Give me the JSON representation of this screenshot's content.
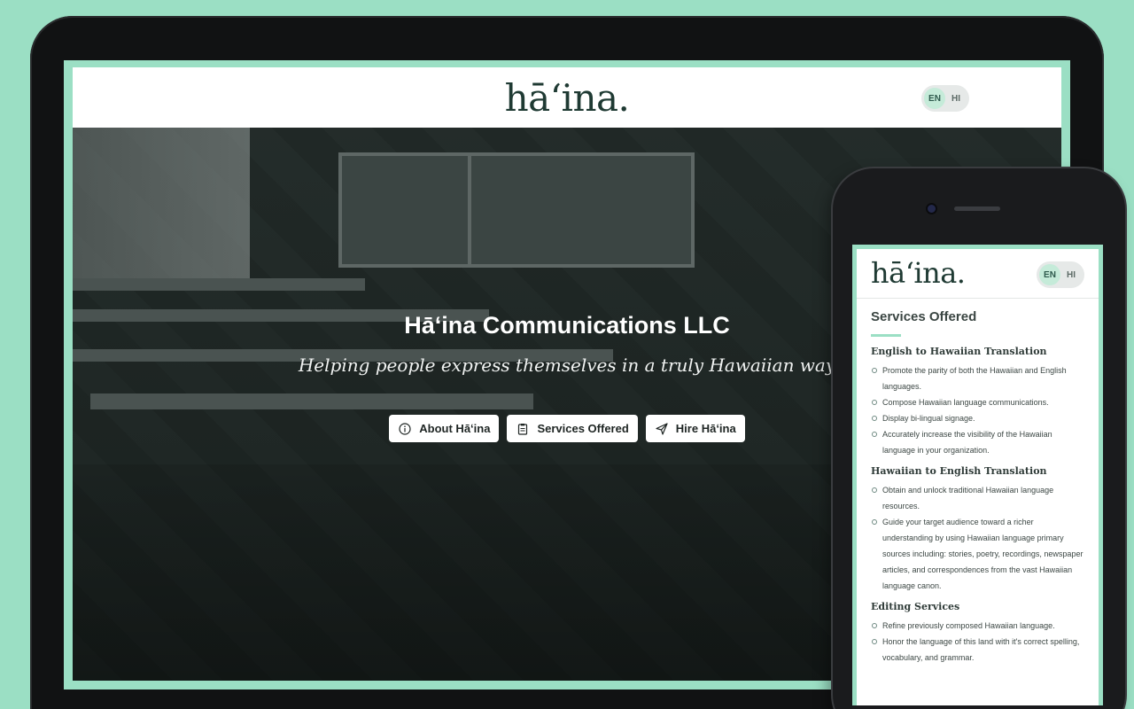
{
  "brand": {
    "logo_text": "hāʻina."
  },
  "lang": {
    "en": "EN",
    "hi": "HI"
  },
  "hero": {
    "title": "Hāʻina Communications LLC",
    "subtitle": "Helping people express themselves in a truly Hawaiian way",
    "buttons": [
      {
        "label": "About Hāʻina",
        "icon": "info-icon"
      },
      {
        "label": "Services Offered",
        "icon": "clipboard-icon"
      },
      {
        "label": "Hire Hāʻina",
        "icon": "send-icon"
      }
    ]
  },
  "mobile": {
    "section_title": "Services Offered",
    "services": [
      {
        "heading": "English to Hawaiian Translation",
        "items": [
          "Promote the parity of both the Hawaiian and English languages.",
          "Compose Hawaiian language communications.",
          "Display bi-lingual signage.",
          "Accurately increase the visibility of the Hawaiian language in your organization."
        ]
      },
      {
        "heading": "Hawaiian to English Translation",
        "items": [
          "Obtain and unlock traditional Hawaiian language resources.",
          "Guide your target audience toward a richer understanding by using Hawaiian language primary sources including: stories, poetry, recordings, newspaper articles, and correspondences from the vast Hawaiian language canon."
        ]
      },
      {
        "heading": "Editing Services",
        "items": [
          "Refine previously composed Hawaiian language.",
          "Honor the language of this land with it's correct spelling, vocabulary, and grammar."
        ]
      }
    ]
  },
  "colors": {
    "accent": "#9bdfc4",
    "logo": "#1f3a33",
    "hero_overlay": "#2a3230"
  }
}
